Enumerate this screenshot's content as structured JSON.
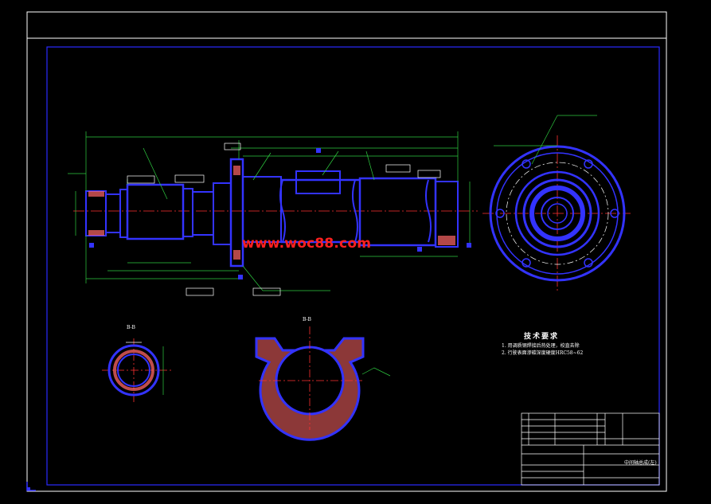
{
  "watermark": "www.woc88.com",
  "colors": {
    "background": "#000000",
    "frame": "#ffffff",
    "inner_frame": "#2a2aff",
    "part_outline": "#3333ff",
    "dimension": "#2ecc40",
    "center_line": "#ff3030",
    "hatch": "#ff6666",
    "text": "#ffffff",
    "watermark": "#ff2020"
  },
  "technical_requirements": {
    "title": "技术要求",
    "items": [
      "1.  用调质钢焊接后热处理，校直去除",
      "2.  行驶表面渗碳深度硬度HRC58~62"
    ]
  },
  "section_labels": {
    "section_small": "B-B",
    "section_fork": "B-B"
  },
  "title_block": {
    "drawing_name": "中间轴总成(左)"
  }
}
